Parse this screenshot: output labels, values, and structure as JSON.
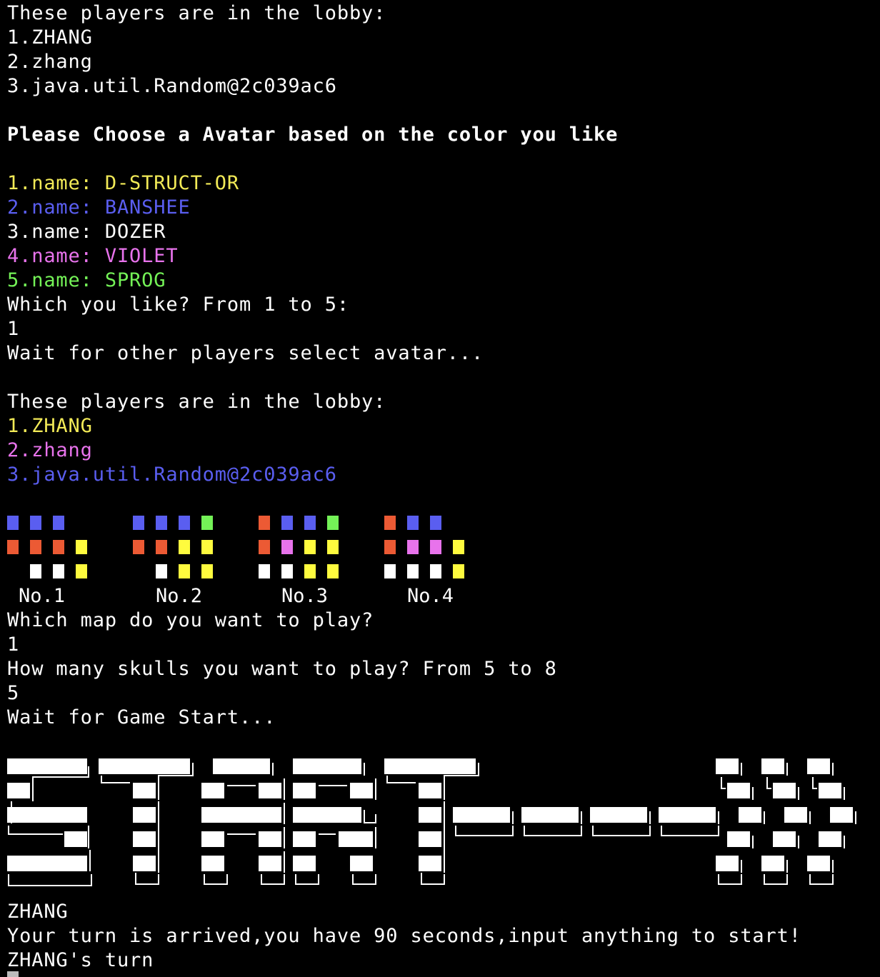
{
  "terminal": {
    "lobby1": {
      "heading": "These players are in the lobby:",
      "players": [
        "1.ZHANG",
        "2.zhang",
        "3.java.util.Random@2c039ac6"
      ]
    },
    "avatar_prompt": "Please Choose a Avatar based on the color you like",
    "avatars": [
      {
        "prefix": "1.name: ",
        "name": "D-STRUCT-OR",
        "color": "#f2ea57"
      },
      {
        "prefix": "2.name: ",
        "name": "BANSHEE",
        "color": "#5a5ef0"
      },
      {
        "prefix": "3.name: ",
        "name": "DOZER",
        "color": "#ffffff"
      },
      {
        "prefix": "4.name: ",
        "name": "VIOLET",
        "color": "#e873ec"
      },
      {
        "prefix": "5.name: ",
        "name": "SPROG",
        "color": "#74f257"
      }
    ],
    "avatar_question": "Which you like? From 1 to 5:",
    "avatar_input": "1",
    "wait_avatar": "Wait for other players select avatar...",
    "lobby2": {
      "heading": "These players are in the lobby:",
      "players": [
        {
          "text": "1.ZHANG",
          "color": "#f2ea57"
        },
        {
          "text": "2.zhang",
          "color": "#e873ec"
        },
        {
          "text": "3.java.util.Random@2c039ac6",
          "color": "#5a5ef0"
        }
      ]
    },
    "map_labels": [
      "No.1",
      "No.2",
      "No.3",
      "No.4"
    ],
    "maps": [
      [
        [
          "blue",
          "blue",
          "blue",
          null
        ],
        [
          "red",
          "red",
          "red",
          "yellow"
        ],
        [
          null,
          "white",
          "white",
          "yellow"
        ]
      ],
      [
        [
          "blue",
          "blue",
          "blue",
          "green"
        ],
        [
          "red",
          "red",
          "yellow",
          "yellow"
        ],
        [
          null,
          "white",
          "yellow",
          "yellow"
        ]
      ],
      [
        [
          "red",
          "blue",
          "blue",
          "green"
        ],
        [
          "red",
          "pink",
          "yellow",
          "yellow"
        ],
        [
          "white",
          "white",
          "yellow",
          "yellow"
        ]
      ],
      [
        [
          "red",
          "blue",
          "blue",
          null
        ],
        [
          "red",
          "pink",
          "pink",
          "yellow"
        ],
        [
          "white",
          "white",
          "white",
          "yellow"
        ]
      ]
    ],
    "map_question": "Which map do you want to play?",
    "map_input": "1",
    "skull_question": "How many skulls you want to play? From 5 to 8",
    "skull_input": "5",
    "wait_start": "Wait for Game Start...",
    "banner_icon": "start-banner-ascii-art",
    "current_player": "ZHANG",
    "turn_message": "Your turn is arrived,you have 90 seconds,input anything to start!",
    "turn_label": "ZHANG's turn"
  }
}
